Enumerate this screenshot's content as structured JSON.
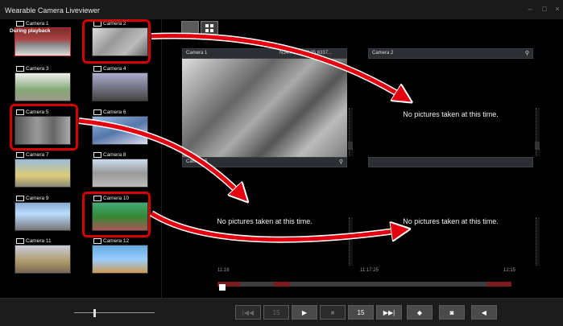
{
  "window": {
    "title": "Wearable Camera Liveviewer",
    "controls": [
      "–",
      "□",
      "×"
    ]
  },
  "sidebar": {
    "cameras": [
      {
        "label": "Camera 1",
        "status": "During playback"
      },
      {
        "label": "Camera 2"
      },
      {
        "label": "Camera 3"
      },
      {
        "label": "Camera 4"
      },
      {
        "label": "Camera 5"
      },
      {
        "label": "Camera 6"
      },
      {
        "label": "Camera 7"
      },
      {
        "label": "Camera 8"
      },
      {
        "label": "Camera 9"
      },
      {
        "label": "Camera 10"
      },
      {
        "label": "Camera 11"
      },
      {
        "label": "Camera 12"
      }
    ]
  },
  "main": {
    "panes": [
      {
        "label": "Camera 1",
        "coords": "N34.759..., E135.6337..."
      },
      {
        "label": "Camera 2",
        "message": "No pictures taken at this time."
      },
      {
        "label": "Camera 5"
      },
      {
        "message": "No pictures taken at this time."
      },
      {
        "message": "No pictures taken at this time."
      }
    ]
  },
  "timeline": {
    "start": "11:16",
    "mid": "11:17:25",
    "end": "12:15"
  },
  "controls": {
    "skip_back": "|◀◀",
    "rewind": "15",
    "play": "▶",
    "stop": "■",
    "forward": "15",
    "skip_fwd": "▶▶|",
    "marker": "◆",
    "snapshot": "◙",
    "audio": "◀"
  },
  "colors": {
    "highlight": "#d40000",
    "background": "#000000"
  }
}
